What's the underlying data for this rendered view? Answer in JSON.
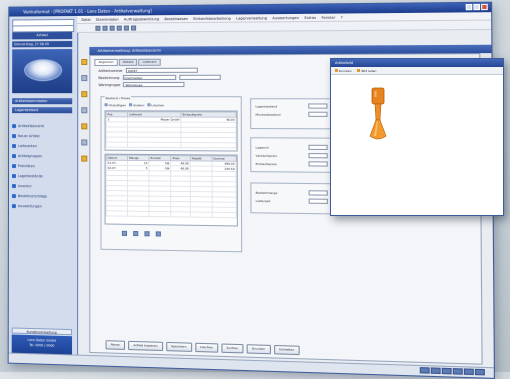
{
  "window": {
    "title": "Ventraformat - [PROFAKT 1.01 - Lens Daten - Artikelverwaltung]"
  },
  "menu": [
    "Datei",
    "Stammdaten",
    "Auftragsabwicklung",
    "Bestellwesen",
    "Einkaufsbearbeitung",
    "Lagerverwaltung",
    "Auswertungen",
    "Extras",
    "Fenster",
    "?"
  ],
  "sidebar": {
    "user": "Artikel",
    "date": "Donnerstag, 27.08.09",
    "section_header_1": "Artikelstammdaten",
    "section_header_2": "Lagerbestand",
    "items": [
      {
        "label": "Artikelübersicht"
      },
      {
        "label": "Neuer Artikel"
      },
      {
        "label": "Lieferanten"
      },
      {
        "label": "Artikelgruppen"
      },
      {
        "label": "Preislisten"
      },
      {
        "label": "Lagerbestände"
      },
      {
        "label": "Inventur"
      },
      {
        "label": "Bestellvorschläge"
      },
      {
        "label": "Auswertungen"
      }
    ],
    "info_header": "Kundenverwaltung",
    "info_line1": "Lens Daten GmbH",
    "info_line2": "Tel. 0000 / 0000"
  },
  "document": {
    "header": "Artikelverwaltung: Artikelübersicht",
    "tabs": [
      "Allgemein",
      "Details",
      "Lieferant"
    ],
    "fields": [
      {
        "label": "Artikelnummer",
        "value": "00087"
      },
      {
        "label": "Bezeichnung",
        "value": "Drehmeißel"
      },
      {
        "label": "Warengruppe",
        "value": "Werkzeuge"
      }
    ],
    "group_label": "Bestand / Preise",
    "mini_toolbar": [
      "Hinzufügen",
      "Ändern",
      "Löschen"
    ],
    "grid1": {
      "headers": [
        "Pos.",
        "Lieferant",
        "Einkaufspreis"
      ],
      "rows": [
        [
          "1",
          "Meyer GmbH",
          "48,90"
        ]
      ]
    },
    "grid2": {
      "headers": [
        "Datum",
        "Menge",
        "Einheit",
        "Preis",
        "Rabatt",
        "Summe"
      ],
      "rows": [
        [
          "01.07.",
          "10",
          "Stk",
          "48,90",
          "",
          "489,00"
        ],
        [
          "02.07.",
          "5",
          "Stk",
          "48,90",
          "",
          "244,50"
        ]
      ]
    },
    "right_labels": [
      "Lagerbestand",
      "Mindestbestand",
      "Lagerort",
      "Verkaufspreis",
      "Einkaufspreis",
      "Bestellmenge",
      "Lieferzeit"
    ],
    "buttons": [
      "Neuer",
      "Artikel kopieren",
      "Speichern",
      "Löschen",
      "Suchen",
      "Drucken",
      "Schließen"
    ]
  },
  "preview": {
    "title": "Artikelbild",
    "toolbar": [
      "Drucken",
      "Bild laden"
    ],
    "image_desc": "orange-tool"
  },
  "colors": {
    "titlebar": "#2b4e9d",
    "sidebar": "#d2dcec",
    "tool": "#e8841f"
  }
}
